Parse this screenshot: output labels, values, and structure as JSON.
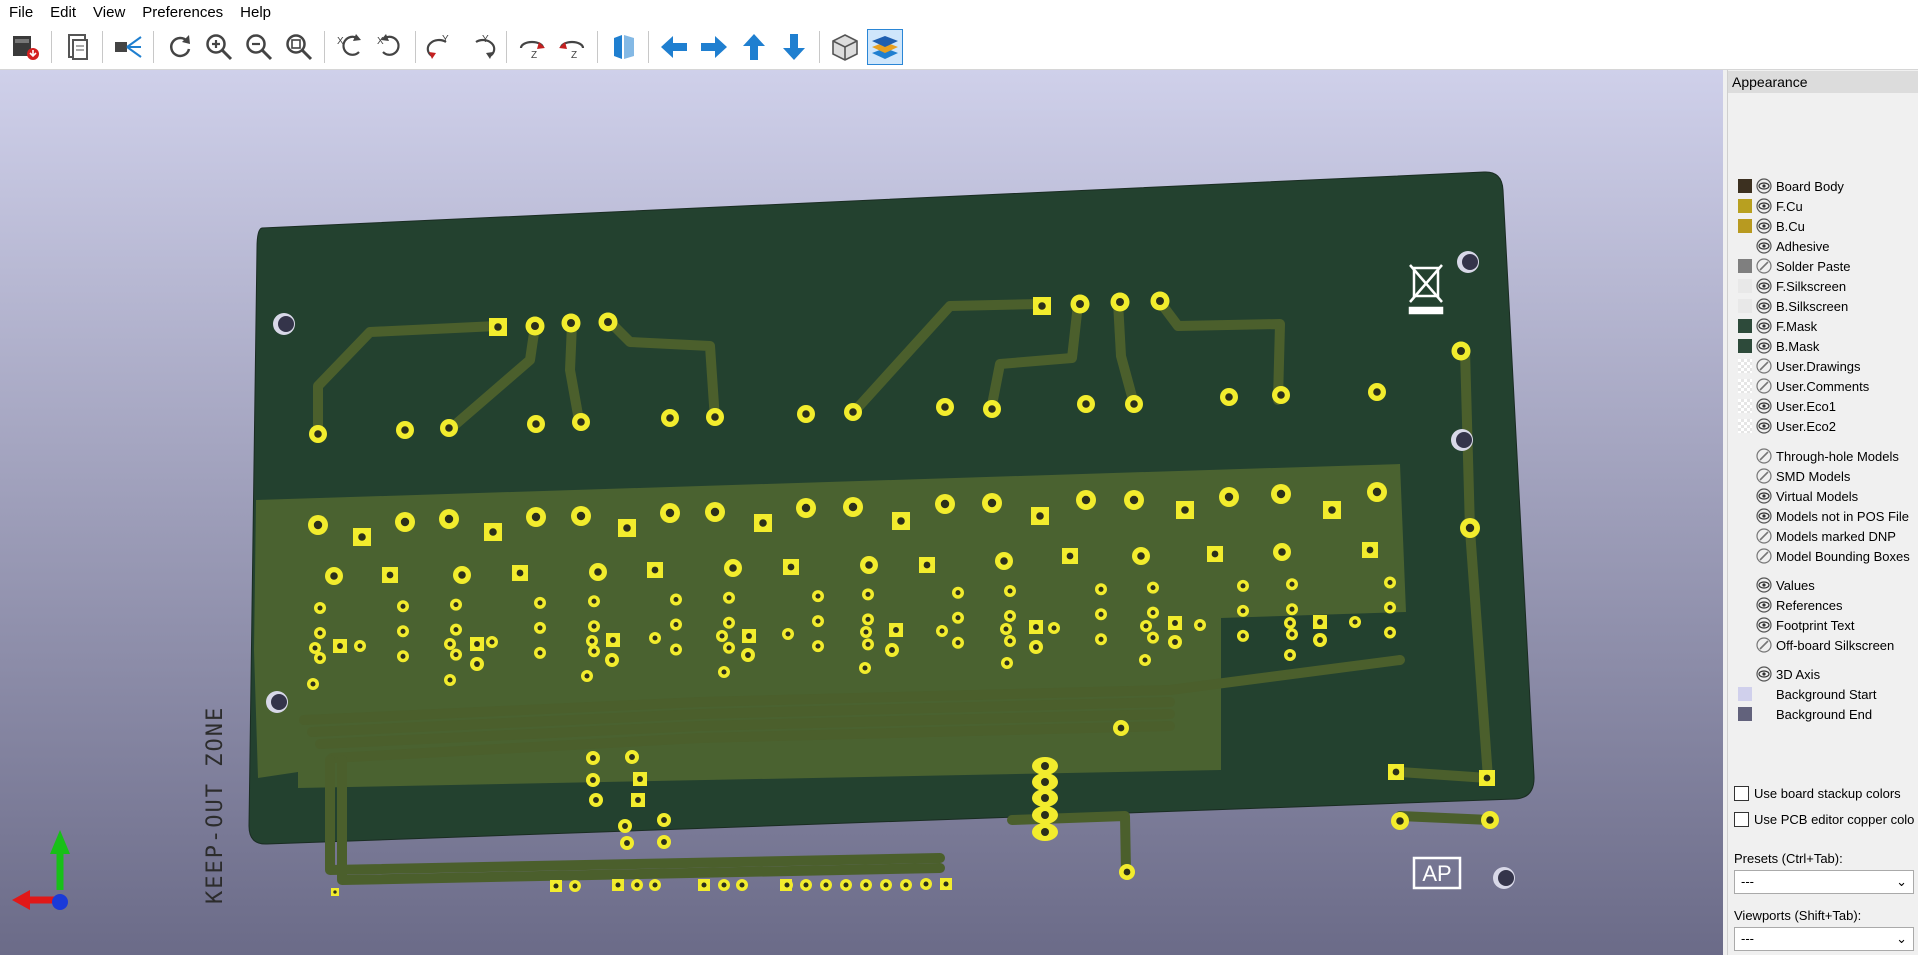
{
  "menu": [
    "File",
    "Edit",
    "View",
    "Preferences",
    "Help"
  ],
  "toolbar": [
    {
      "name": "export-image-icon"
    },
    {
      "sep": true
    },
    {
      "name": "copy-clipboard-icon"
    },
    {
      "sep": true
    },
    {
      "name": "raytrace-icon"
    },
    {
      "sep": true
    },
    {
      "name": "redraw-icon"
    },
    {
      "name": "zoom-in-icon"
    },
    {
      "name": "zoom-out-icon"
    },
    {
      "name": "zoom-fit-icon"
    },
    {
      "sep": true
    },
    {
      "name": "rotate-x-cw-icon"
    },
    {
      "name": "rotate-x-ccw-icon"
    },
    {
      "sep": true
    },
    {
      "name": "rotate-y-cw-icon"
    },
    {
      "name": "rotate-y-ccw-icon"
    },
    {
      "sep": true
    },
    {
      "name": "rotate-z-cw-icon"
    },
    {
      "name": "rotate-z-ccw-icon"
    },
    {
      "sep": true
    },
    {
      "name": "flip-board-icon"
    },
    {
      "sep": true
    },
    {
      "name": "move-left-icon"
    },
    {
      "name": "move-right-icon"
    },
    {
      "name": "move-up-icon"
    },
    {
      "name": "move-down-icon"
    },
    {
      "sep": true
    },
    {
      "name": "toggle-orthographic-icon"
    },
    {
      "name": "show-layers-manager-icon",
      "active": true
    }
  ],
  "colors": {
    "viewport_top": "#cfd0ea",
    "viewport_bottom": "#6b6b88",
    "board": "#23412f",
    "ground_pour": "#4a6230",
    "pad": "#f2ec2d",
    "hole": "#2a2a2a",
    "accent": "#2a86d6"
  },
  "board": {
    "keepout_text": "KEEP-OUT ZONE",
    "logo_text": "AP"
  },
  "panel": {
    "title": "Appearance",
    "layers": [
      {
        "label": "Board Body",
        "swatch": "#3c3020",
        "eye": "visible"
      },
      {
        "label": "F.Cu",
        "swatch": "#b8a020",
        "eye": "visible"
      },
      {
        "label": "B.Cu",
        "swatch": "#b89a20",
        "eye": "visible"
      },
      {
        "label": "Adhesive",
        "swatch": "",
        "eye": "visible"
      },
      {
        "label": "Solder Paste",
        "swatch": "#7f7f7f",
        "eye": "hidden"
      },
      {
        "label": "F.Silkscreen",
        "swatch": "#e8e8e8",
        "eye": "visible"
      },
      {
        "label": "B.Silkscreen",
        "swatch": "#e8e8e8",
        "eye": "visible"
      },
      {
        "label": "F.Mask",
        "swatch": "#2d4a3a",
        "eye": "visible"
      },
      {
        "label": "B.Mask",
        "swatch": "#2d4a3a",
        "eye": "visible"
      },
      {
        "label": "User.Drawings",
        "swatch": "checker",
        "eye": "hidden"
      },
      {
        "label": "User.Comments",
        "swatch": "checker",
        "eye": "hidden"
      },
      {
        "label": "User.Eco1",
        "swatch": "checker",
        "eye": "visible"
      },
      {
        "label": "User.Eco2",
        "swatch": "checker",
        "eye": "visible"
      },
      {
        "label": "Through-hole Models",
        "swatch": "",
        "eye": "hidden"
      },
      {
        "label": "SMD Models",
        "swatch": "",
        "eye": "hidden"
      },
      {
        "label": "Virtual Models",
        "swatch": "",
        "eye": "visible"
      },
      {
        "label": "Models not in POS File",
        "swatch": "",
        "eye": "visible"
      },
      {
        "label": "Models marked DNP",
        "swatch": "",
        "eye": "hidden"
      },
      {
        "label": "Model Bounding Boxes",
        "swatch": "",
        "eye": "hidden"
      },
      {
        "label": "Values",
        "swatch": "",
        "eye": "visible"
      },
      {
        "label": "References",
        "swatch": "",
        "eye": "visible"
      },
      {
        "label": "Footprint Text",
        "swatch": "",
        "eye": "visible"
      },
      {
        "label": "Off-board Silkscreen",
        "swatch": "",
        "eye": "hidden"
      },
      {
        "label": "3D Axis",
        "swatch": "",
        "eye": "visible"
      },
      {
        "label": "Background Start",
        "swatch": "#d0d0ec",
        "eye": ""
      },
      {
        "label": "Background End",
        "swatch": "#62627c",
        "eye": ""
      }
    ],
    "checkbox_stackup": "Use board stackup colors",
    "checkbox_copper": "Use PCB editor copper colo",
    "presets_label": "Presets (Ctrl+Tab):",
    "presets_value": "---",
    "viewports_label": "Viewports (Shift+Tab):",
    "viewports_value": "---"
  }
}
